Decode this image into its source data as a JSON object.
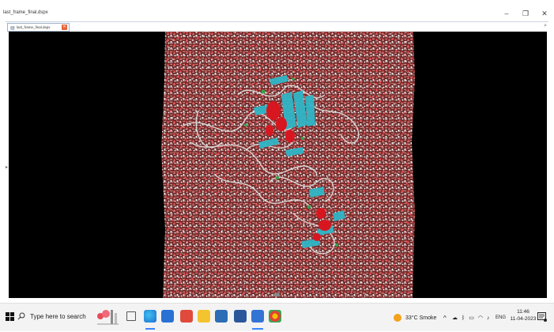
{
  "window": {
    "title": "last_frame_final.dspx",
    "tab_label": "last_frame_final.dspx"
  },
  "taskbar": {
    "search_placeholder": "Type here to search",
    "weather": "33°C  Smoke",
    "language": "ENG",
    "time": "11:46",
    "date": "11-04-2023"
  },
  "colors": {
    "water_bg": "#6e2a2a",
    "ribbon_cyan": "#2fb6c6",
    "helix_red": "#d8161f",
    "coil_white": "#d9d9d9",
    "ligand_green": "#2fa54a"
  }
}
